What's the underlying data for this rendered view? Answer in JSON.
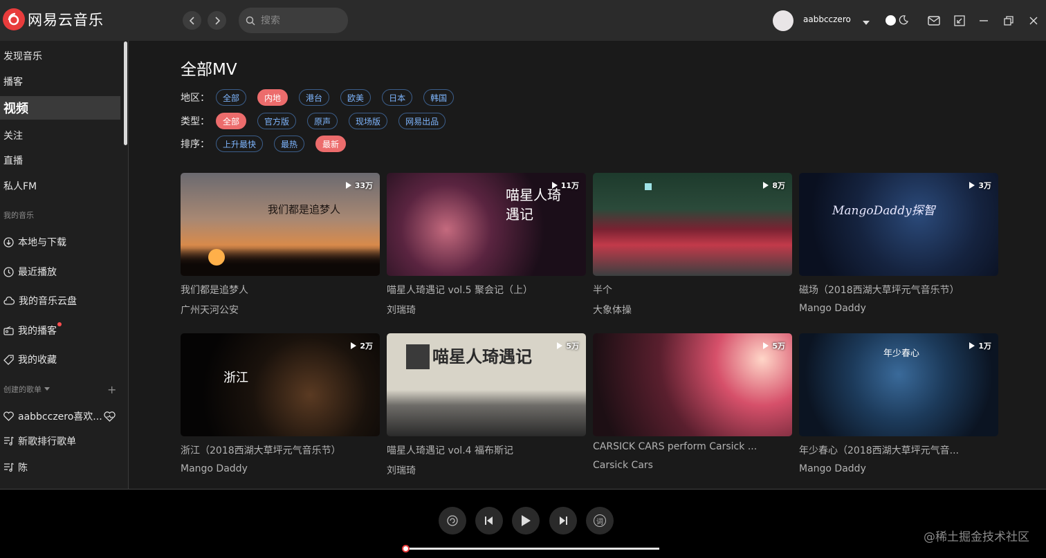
{
  "app": {
    "name": "网易云音乐",
    "brand_color": "#e83c3c"
  },
  "header": {
    "search_placeholder": "搜索",
    "username": "aabbcczero"
  },
  "sidebar": {
    "items": [
      {
        "label": "发现音乐"
      },
      {
        "label": "播客"
      },
      {
        "label": "视频",
        "active": true
      },
      {
        "label": "关注"
      },
      {
        "label": "直播"
      },
      {
        "label": "私人FM"
      }
    ],
    "my_music_title": "我的音乐",
    "my_music": [
      {
        "label": "本地与下载",
        "icon": "download-icon"
      },
      {
        "label": "最近播放",
        "icon": "clock-icon"
      },
      {
        "label": "我的音乐云盘",
        "icon": "cloud-icon"
      },
      {
        "label": "我的播客",
        "icon": "radio-icon"
      },
      {
        "label": "我的收藏",
        "icon": "tag-icon"
      }
    ],
    "created_title": "创建的歌单",
    "playlists": [
      {
        "label": "aabbcczero喜欢...",
        "icon": "heart-icon"
      },
      {
        "label": "新歌排行歌单",
        "icon": "playlist-icon"
      },
      {
        "label": "陈",
        "icon": "playlist-icon"
      }
    ]
  },
  "main": {
    "title": "全部MV",
    "filters": [
      {
        "label": "地区：",
        "options": [
          "全部",
          "内地",
          "港台",
          "欧美",
          "日本",
          "韩国"
        ],
        "selected": "内地"
      },
      {
        "label": "类型：",
        "options": [
          "全部",
          "官方版",
          "原声",
          "现场版",
          "网易出品"
        ],
        "selected": "全部"
      },
      {
        "label": "排序：",
        "options": [
          "上升最快",
          "最热",
          "最新"
        ],
        "selected": "最新"
      }
    ],
    "videos": [
      {
        "title": "我们都是追梦人",
        "artist": "广州天河公安",
        "plays": "33万",
        "overlay": "我们都是追梦人"
      },
      {
        "title": "喵星人琦遇记 vol.5 聚会记（上）",
        "artist": "刘瑞琦",
        "plays": "11万",
        "overlay": "喵星人琦遇记"
      },
      {
        "title": "半个",
        "artist": "大象体操",
        "plays": "8万",
        "overlay": ""
      },
      {
        "title": "磁场（2018西湖大草坪元气音乐节）",
        "artist": "Mango Daddy",
        "plays": "3万",
        "overlay": "MangoDaddy探智"
      },
      {
        "title": "浙江（2018西湖大草坪元气音乐节）",
        "artist": "Mango Daddy",
        "plays": "2万",
        "overlay": "浙江"
      },
      {
        "title": "喵星人琦遇记 vol.4 福布斯记",
        "artist": "刘瑞琦",
        "plays": "5万",
        "overlay": "喵星人琦遇记"
      },
      {
        "title": "CARSICK CARS perform Carsick ...",
        "artist": "Carsick Cars",
        "plays": "5万",
        "overlay": ""
      },
      {
        "title": "年少春心（2018西湖大草坪元气音...",
        "artist": "Mango Daddy",
        "plays": "1万",
        "overlay": "年少春心"
      }
    ]
  },
  "player": {
    "progress": 0.0
  },
  "watermark": "@稀土掘金技术社区"
}
